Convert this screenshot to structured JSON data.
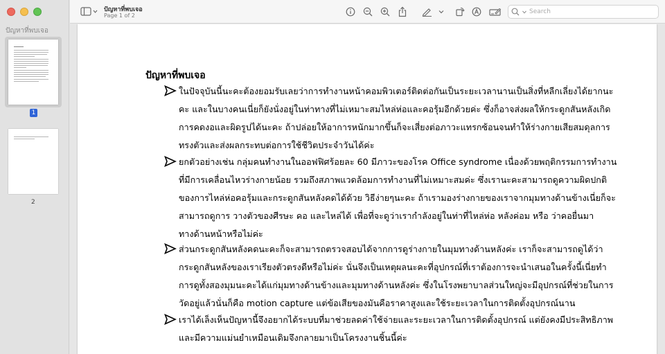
{
  "sidebar": {
    "title": "ปัญหาที่พบเจอ",
    "pages": [
      {
        "label": "1",
        "selected": true
      },
      {
        "label": "2",
        "selected": false
      }
    ]
  },
  "toolbar": {
    "doc_title": "ปัญหาที่พบเจอ",
    "doc_subtitle": "Page 1 of 2",
    "search_placeholder": "Search"
  },
  "document": {
    "heading": "ปัญหาที่พบเจอ",
    "bullets": [
      {
        "lines": [
          "ในปัจจุบันนี้นะคะต้องยอมรับเลยว่าการทำงานหน้าคอมพิวเตอร์ติดต่อกันเป็นระยะเวลานานเป็นสิ่งที่หลีกเลี่ยงได้ยากนะ",
          "คะ และในบางคนเนี่ยก็ยังนั่งอยู่ในท่าทางที่ไม่เหมาะสมไหล่ห่อและคอรุ้มอีกด้วยค่ะ ซึ่งก็อาจส่งผลให้กระดูกสันหลังเกิด",
          "การคดงอและผิดรูปได้นะคะ ถ้าปล่อยให้อาการหนักมากขึ้นก็จะเสี่ยงต่อภาวะแทรกซ้อนจนทำให้ร่างกายเสียสมดุลการ",
          "ทรงตัวและส่งผลกระทบต่อการใช้ชีวิตประจำวันได้ค่ะ"
        ]
      },
      {
        "lines": [
          "ยกตัวอย่างเช่น กลุ่มคนทำงานในออฟฟิศร้อยละ 60 มีภาวะของโรค Office syndrome เนื่องด้วยพฤติกรรมการทำงาน",
          "ที่มีการเคลื่อนไหวร่างกายน้อย รวมถึงสภาพแวดล้อมการทำงานที่ไม่เหมาะสมค่ะ ซึ่งเรานะคะสามารถดูความผิดปกติ",
          "ของการไหล่ห่อคอรุ้มและกระดูกสันหลังคดได้ด้วย วิธีง่ายๆนะคะ ถ้าเรามองร่างกายของเราจากมุมทางด้านข้างเนี่ยก็จะ",
          "สามารถดูการ วางตัวของศีรษะ คอ และไหล่ได้ เพื่อที่จะดูว่าเรากำลังอยู่ในท่าที่ไหล่ห่อ หลังค่อม หรือ ว่าคอยื่นมา",
          "ทางด้านหน้าหรือไม่ค่ะ"
        ]
      },
      {
        "lines": [
          "ส่วนกระดูกสันหลังคดนะคะก็จะสามารถตรวจสอบได้จากการดูร่างกายในมุมทางด้านหลังค่ะ เราก็จะสามารถดูได้ว่า",
          "กระดูกสันหลังของเราเรียงตัวตรงดีหรือไม่ค่ะ นั่นจึงเป็นเหตุผลนะคะที่อุปกรณ์ที่เราต้องการจะนำเสนอในครั้งนี้เนี่ยทำ",
          "การดูทั้งสองมุมนะคะได้แก่มุมทางด้านข้างและมุมทางด้านหลังค่ะ ซึ่งในโรงพยาบาลส่วนใหญ่จะมีอุปกรณ์ที่ช่วยในการ",
          "วัดอยู่แล้วนั่นก็คือ motion capture แต่ข้อเสียของมันคือราคาสูงและใช้ระยะเวลาในการติดตั้งอุปกรณ์นาน"
        ]
      },
      {
        "lines": [
          "เราได้เล็งเห็นปัญหานี้จึงอยากได้ระบบที่มาช่วยลดค่าใช้จ่ายและระยะเวลาในการติดตั้งอุปกรณ์ แต่ยังคงมีประสิทธิภาพ",
          "และมีความแม่นยำเหมือนเดิมจึงกลายมาเป็นโครงงานชิ้นนี้ค่ะ"
        ]
      }
    ]
  }
}
